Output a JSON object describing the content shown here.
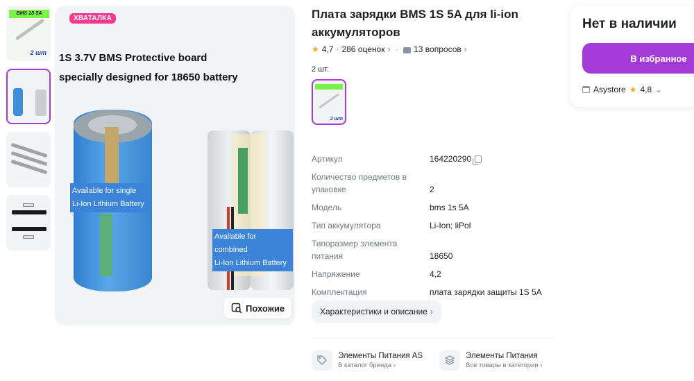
{
  "main_image": {
    "badge": "ХВАТАЛКА",
    "title_line1": "1S 3.7V BMS Protective board",
    "title_line2": "specially designed for 18650 battery",
    "caption_single_1": "Available for single",
    "caption_single_2": "Li-Ion Lithium Battery",
    "caption_combined_1": "Available for combined",
    "caption_combined_2": "Li-Ion Lithium Battery",
    "similar_label": "Похожие"
  },
  "thumbs": {
    "t1_tag": "Плата Зарядки Защиты BMS 1S 5A",
    "t1_count": "2 шт",
    "t2_title": "1S 3.7V BMS Protective board specially designed for 18650 battery"
  },
  "product": {
    "title": "Плата зарядки BMS 1S 5A для li-ion аккумуляторов",
    "rating": "4,7",
    "reviews": "286 оценок",
    "questions": "13 вопросов",
    "pack_label": "2 шт.",
    "variant_count": "2 шт"
  },
  "specs": [
    {
      "key": "Артикул",
      "value": "164220290"
    },
    {
      "key": "Количество предметов в упаковке",
      "value": "2"
    },
    {
      "key": "Модель",
      "value": "bms 1s 5A"
    },
    {
      "key": "Тип аккумулятора",
      "value": "Li-Ion; liPol"
    },
    {
      "key": "Типоразмер элемента питания",
      "value": "18650"
    },
    {
      "key": "Напряжение",
      "value": "4,2"
    },
    {
      "key": "Комплектация",
      "value": "плата зарядки защиты 1S 5A"
    }
  ],
  "char_button": "Характеристики и описание",
  "brand_links": [
    {
      "title": "Элементы Питания AS",
      "subtitle": "В каталог бренда"
    },
    {
      "title": "Элементы Питания",
      "subtitle": "Все товары в категории"
    }
  ],
  "card": {
    "status": "Нет в наличии",
    "favorite_button": "В избранное",
    "seller": "Asystore",
    "seller_rating": "4,8"
  },
  "colors": {
    "accent": "#a43bd8",
    "badge": "#f23a8e",
    "star": "#f6a623",
    "muted": "#707784"
  }
}
